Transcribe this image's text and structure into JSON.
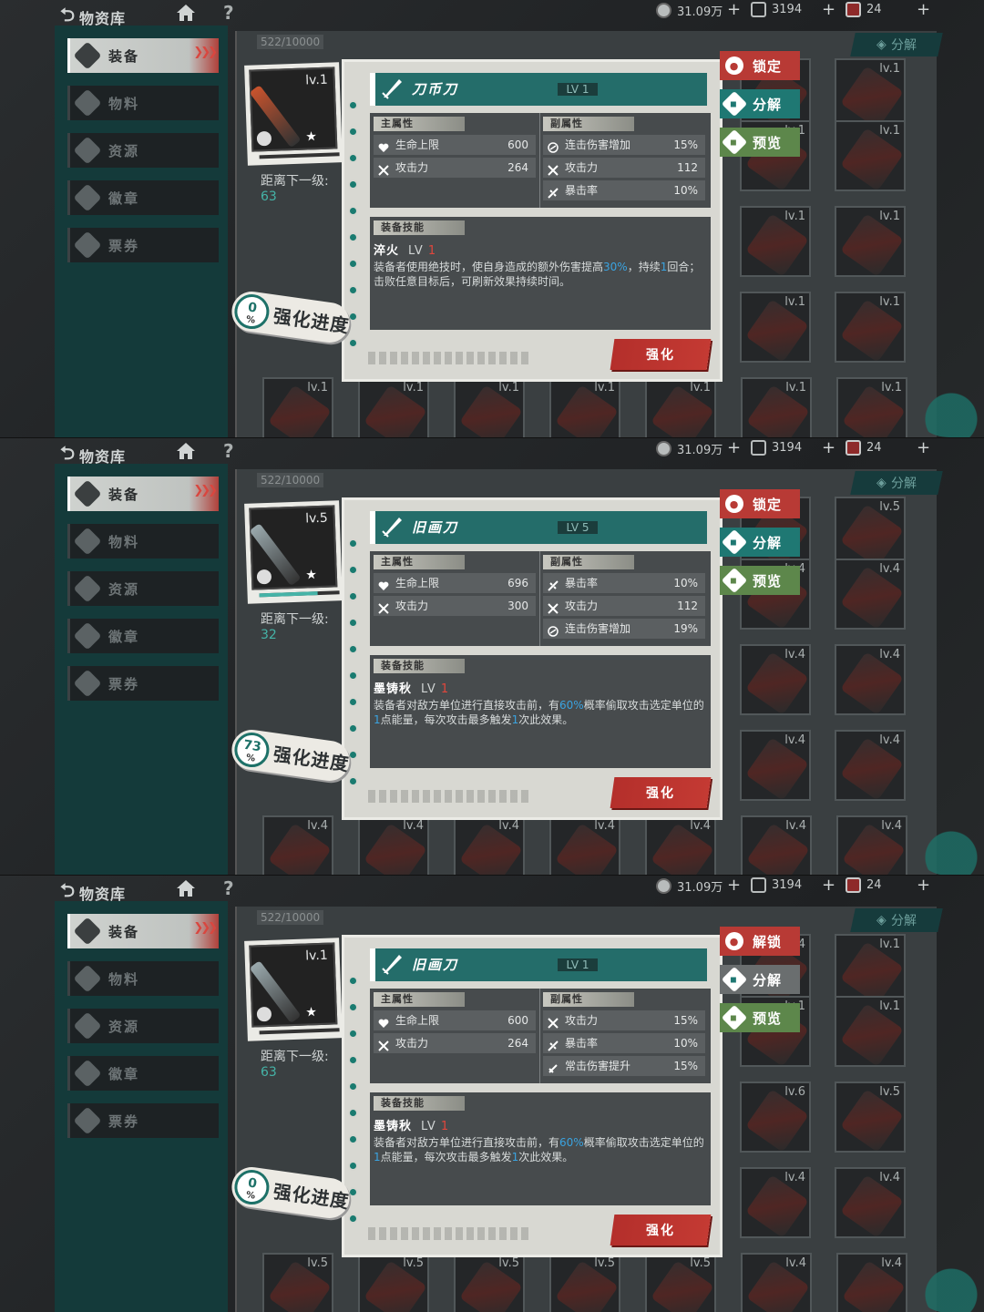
{
  "colors": {
    "accent": "#246d6a",
    "red": "#b83a35",
    "green": "#5d874b",
    "highlight": "#3aa3e0"
  },
  "panels": [
    {
      "topbar": {
        "back_label": "物资库",
        "coins": "31.09万",
        "gems": "3194",
        "tickets": "24"
      },
      "menu": [
        "装备",
        "物料",
        "资源",
        "徽章",
        "票券"
      ],
      "count": "522/10000",
      "decompose_top": "分解",
      "item": {
        "name": "刀币刀",
        "lv_badge": "LV 1",
        "preview_lv": "lv.1",
        "next_label": "距离下一级:",
        "next_value": "63",
        "progress_pct": "0",
        "progress_unit": "%",
        "progress_label": "强化进度",
        "weapon_color": "#c8532d",
        "exp_fill": 0
      },
      "main_title": "主属性",
      "sub_title": "副属性",
      "main_attrs": [
        {
          "icon": "heart-icon",
          "name": "生命上限",
          "value": "600"
        },
        {
          "icon": "swords-icon",
          "name": "攻击力",
          "value": "264"
        }
      ],
      "sub_attrs": [
        {
          "icon": "combo-icon",
          "name": "连击伤害增加",
          "value": "15%"
        },
        {
          "icon": "swords-icon",
          "name": "攻击力",
          "value": "112"
        },
        {
          "icon": "crit-icon",
          "name": "暴击率",
          "value": "10%"
        }
      ],
      "skill_title": "装备技能",
      "skill": {
        "name": "淬火",
        "lv_prefix": "LV",
        "lv": "1",
        "desc": [
          "装备者使用绝技时，使自身造成的额外伤害提高",
          "30%",
          "，持续",
          "1",
          "回合；击败任意目标后，可刷新效果持续时间。"
        ]
      },
      "upgrade_label": "强化",
      "side": [
        {
          "type": "lock",
          "label": "锁定",
          "icon": "lock-icon"
        },
        {
          "type": "decomp",
          "label": "分解",
          "icon": "decompose-icon"
        },
        {
          "type": "prev",
          "label": "预览",
          "icon": "preview-icon"
        }
      ],
      "grid_right": [
        "",
        "lv.1",
        "lv.1",
        "lv.1",
        "lv.1",
        "lv.1",
        "lv.1",
        "lv.1"
      ],
      "grid_bottom": [
        "lv.1",
        "lv.1",
        "lv.1",
        "lv.1",
        "lv.1",
        "lv.1",
        "lv.1"
      ]
    },
    {
      "topbar": {
        "back_label": "物资库",
        "coins": "31.09万",
        "gems": "3194",
        "tickets": "24"
      },
      "menu": [
        "装备",
        "物料",
        "资源",
        "徽章",
        "票券"
      ],
      "count": "522/10000",
      "decompose_top": "分解",
      "item": {
        "name": "旧画刀",
        "lv_badge": "LV 5",
        "preview_lv": "lv.5",
        "next_label": "距离下一级:",
        "next_value": "32",
        "progress_pct": "73",
        "progress_unit": "%",
        "progress_label": "强化进度",
        "weapon_color": "#9aa9ad",
        "exp_fill": 0.73
      },
      "main_title": "主属性",
      "sub_title": "副属性",
      "main_attrs": [
        {
          "icon": "heart-icon",
          "name": "生命上限",
          "value": "696"
        },
        {
          "icon": "swords-icon",
          "name": "攻击力",
          "value": "300"
        }
      ],
      "sub_attrs": [
        {
          "icon": "crit-icon",
          "name": "暴击率",
          "value": "10%"
        },
        {
          "icon": "swords-icon",
          "name": "攻击力",
          "value": "112"
        },
        {
          "icon": "combo-icon",
          "name": "连击伤害增加",
          "value": "19%"
        }
      ],
      "skill_title": "装备技能",
      "skill": {
        "name": "墨铸秋",
        "lv_prefix": "LV",
        "lv": "1",
        "desc": [
          "装备者对敌方单位进行直接攻击前，有",
          "60%",
          "概率偷取攻击选定单位的",
          "1",
          "点能量，每次攻击最多触发",
          "1",
          "次此效果。"
        ]
      },
      "upgrade_label": "强化",
      "side": [
        {
          "type": "lock",
          "label": "锁定",
          "icon": "lock-icon"
        },
        {
          "type": "decomp",
          "label": "分解",
          "icon": "decompose-icon"
        },
        {
          "type": "prev",
          "label": "预览",
          "icon": "preview-icon"
        }
      ],
      "grid_right": [
        "",
        "lv.5",
        "lv.4",
        "lv.4",
        "lv.4",
        "lv.4",
        "lv.4",
        "lv.4"
      ],
      "grid_bottom": [
        "lv.4",
        "lv.4",
        "lv.4",
        "lv.4",
        "lv.4",
        "lv.4",
        "lv.4"
      ]
    },
    {
      "topbar": {
        "back_label": "物资库",
        "coins": "31.09万",
        "gems": "3194",
        "tickets": "24"
      },
      "menu": [
        "装备",
        "物料",
        "资源",
        "徽章",
        "票券"
      ],
      "count": "522/10000",
      "decompose_top": "分解",
      "item": {
        "name": "旧画刀",
        "lv_badge": "LV 1",
        "preview_lv": "lv.1",
        "next_label": "距离下一级:",
        "next_value": "63",
        "progress_pct": "0",
        "progress_unit": "%",
        "progress_label": "强化进度",
        "weapon_color": "#9aa9ad",
        "exp_fill": 0
      },
      "main_title": "主属性",
      "sub_title": "副属性",
      "main_attrs": [
        {
          "icon": "heart-icon",
          "name": "生命上限",
          "value": "600"
        },
        {
          "icon": "swords-icon",
          "name": "攻击力",
          "value": "264"
        }
      ],
      "sub_attrs": [
        {
          "icon": "swords-icon",
          "name": "攻击力",
          "value": "15%"
        },
        {
          "icon": "crit-icon",
          "name": "暴击率",
          "value": "10%"
        },
        {
          "icon": "normal-dmg-icon",
          "name": "常击伤害提升",
          "value": "15%"
        }
      ],
      "skill_title": "装备技能",
      "skill": {
        "name": "墨铸秋",
        "lv_prefix": "LV",
        "lv": "1",
        "desc": [
          "装备者对敌方单位进行直接攻击前，有",
          "60%",
          "概率偷取攻击选定单位的",
          "1",
          "点能量，每次攻击最多触发",
          "1",
          "次此效果。"
        ]
      },
      "upgrade_label": "强化",
      "side": [
        {
          "type": "lock",
          "label": "解锁",
          "icon": "unlock-icon"
        },
        {
          "type": "decomp grey",
          "label": "分解",
          "icon": "decompose-icon"
        },
        {
          "type": "prev",
          "label": "预览",
          "icon": "preview-icon"
        }
      ],
      "grid_right": [
        "lv.4",
        "lv.1",
        "lv.1",
        "lv.1",
        "lv.6",
        "lv.5",
        "lv.4",
        "lv.4"
      ],
      "grid_bottom": [
        "lv.5",
        "lv.5",
        "lv.5",
        "lv.5",
        "lv.5",
        "lv.4",
        "lv.4"
      ]
    }
  ]
}
